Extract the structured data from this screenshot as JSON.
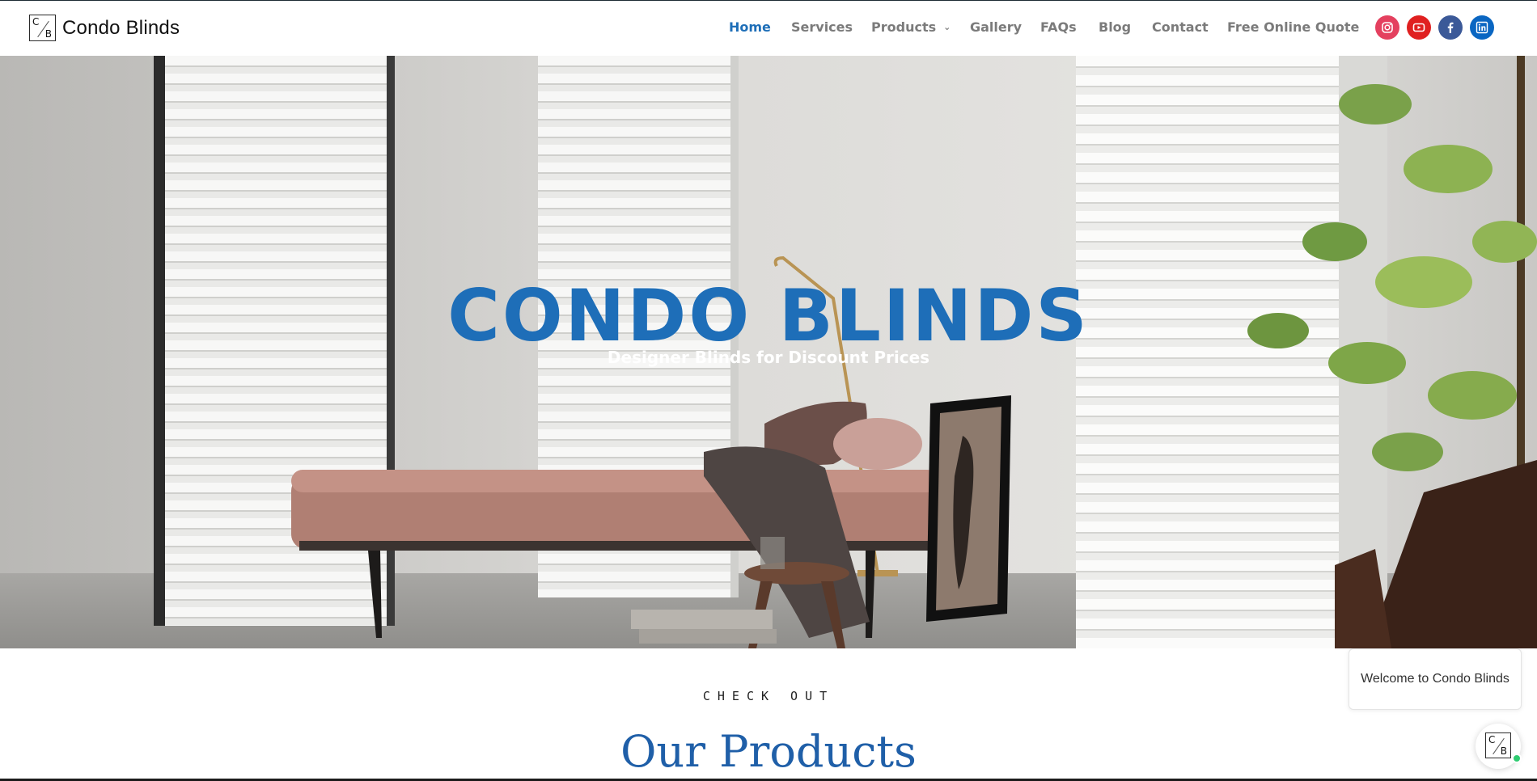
{
  "brand": {
    "name": "Condo Blinds",
    "mark_top": "C",
    "mark_bottom": "B"
  },
  "nav": {
    "home": "Home",
    "services": "Services",
    "products": "Products",
    "gallery": "Gallery",
    "faqs": "FAQs",
    "blog": "Blog",
    "contact": "Contact",
    "quote": "Free Online Quote",
    "active_color": "#1f6fb8"
  },
  "social": [
    "instagram-icon",
    "youtube-icon",
    "facebook-icon",
    "linkedin-icon"
  ],
  "hero": {
    "title": "CONDO BLINDS",
    "subtitle": "Designer Blinds for Discount Prices",
    "title_color": "#1e6eb8"
  },
  "products_section": {
    "eyebrow": "CHECK OUT",
    "title": "Our Products"
  },
  "chat": {
    "greeting": "Welcome to Condo Blinds",
    "status": "online"
  }
}
